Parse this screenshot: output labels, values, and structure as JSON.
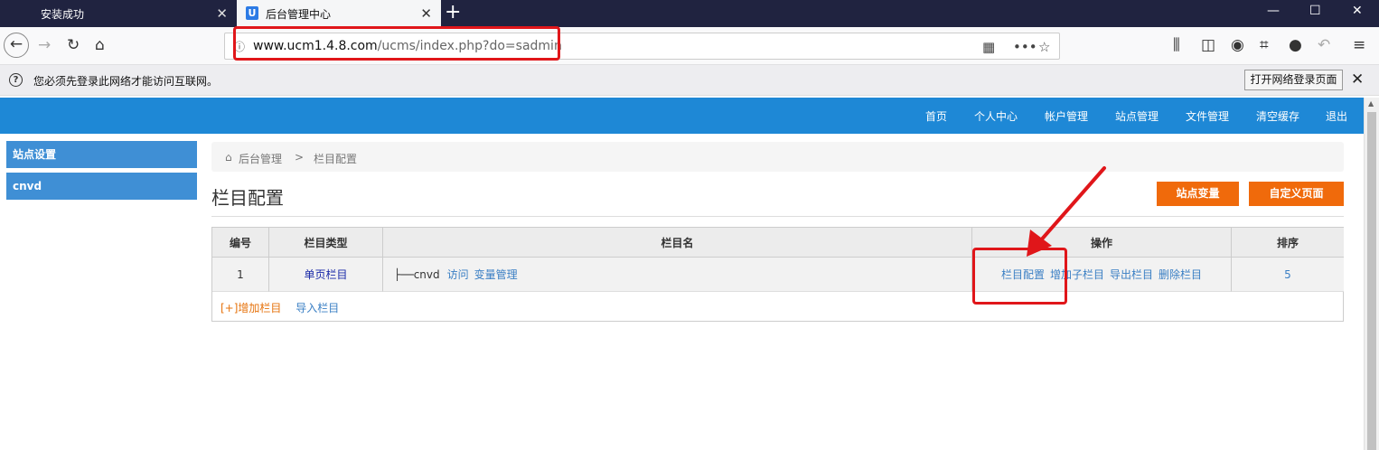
{
  "browser": {
    "tabs": [
      {
        "label": "安装成功",
        "active": false
      },
      {
        "label": "后台管理中心",
        "active": true
      }
    ],
    "url_host": "www.ucm1.4.8.com",
    "url_path": "/ucms/index.php?do=sadmin",
    "notification": {
      "text": "您必须先登录此网络才能访问互联网。",
      "button": "打开网络登录页面"
    }
  },
  "app_nav": {
    "items": [
      "首页",
      "个人中心",
      "帐户管理",
      "站点管理",
      "文件管理",
      "清空缓存",
      "退出"
    ]
  },
  "sidebar": {
    "items": [
      "站点设置",
      "cnvd"
    ]
  },
  "breadcrumb": {
    "home": "后台管理",
    "sep": ">",
    "current": "栏目配置"
  },
  "page": {
    "title": "栏目配置",
    "buttons": [
      "站点变量",
      "自定义页面"
    ]
  },
  "table": {
    "headers": [
      "编号",
      "栏目类型",
      "栏目名",
      "操作",
      "排序"
    ],
    "rows": [
      {
        "id": "1",
        "type": "单页栏目",
        "prefix": "├──",
        "name": "cnvd",
        "visit": "访问",
        "vars": "变量管理",
        "ops": [
          "栏目配置",
          "增加子栏目",
          "导出栏目",
          "删除栏目"
        ],
        "order": "5"
      }
    ],
    "footer": {
      "add": "[+]增加栏目",
      "import": "导入栏目"
    }
  },
  "colors": {
    "accent": "#1e88d6",
    "orange": "#f06a0b",
    "annotation": "#e0161a"
  }
}
